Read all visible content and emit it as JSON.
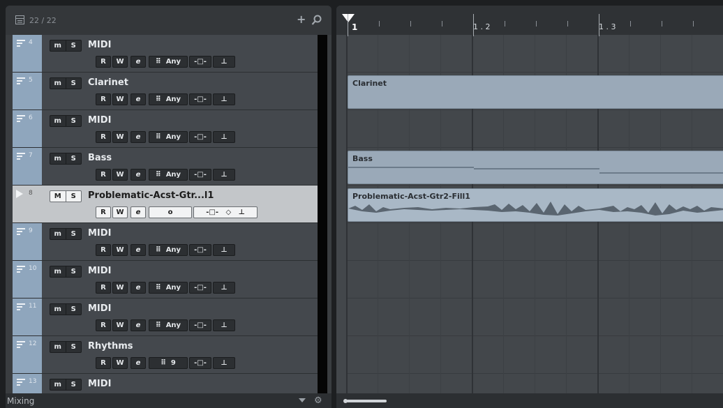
{
  "tracklist": {
    "count": "22 / 22",
    "add_icon": "plus-icon",
    "search_icon": "search-icon",
    "footer_label": "Mixing",
    "tracks": [
      {
        "num": "4",
        "name": "MIDI",
        "mute": "m",
        "solo": "S",
        "r": "R",
        "w": "W",
        "e": "e",
        "kbd": "⠿",
        "mode": "Any",
        "selected": false
      },
      {
        "num": "5",
        "name": "Clarinet",
        "mute": "m",
        "solo": "S",
        "r": "R",
        "w": "W",
        "e": "e",
        "kbd": "⠿",
        "mode": "Any",
        "selected": false
      },
      {
        "num": "6",
        "name": "MIDI",
        "mute": "m",
        "solo": "S",
        "r": "R",
        "w": "W",
        "e": "e",
        "kbd": "⠿",
        "mode": "Any",
        "selected": false
      },
      {
        "num": "7",
        "name": "Bass",
        "mute": "m",
        "solo": "S",
        "r": "R",
        "w": "W",
        "e": "e",
        "kbd": "⠿",
        "mode": "Any",
        "selected": false
      },
      {
        "num": "8",
        "name": "Problematic-Acst-Gtr...l1",
        "mute": "M",
        "solo": "S",
        "r": "R",
        "w": "W",
        "e": "e",
        "kbd": "o",
        "mode": "",
        "selected": true
      },
      {
        "num": "9",
        "name": "MIDI",
        "mute": "m",
        "solo": "S",
        "r": "R",
        "w": "W",
        "e": "e",
        "kbd": "⠿",
        "mode": "Any",
        "selected": false
      },
      {
        "num": "10",
        "name": "MIDI",
        "mute": "m",
        "solo": "S",
        "r": "R",
        "w": "W",
        "e": "e",
        "kbd": "⠿",
        "mode": "Any",
        "selected": false
      },
      {
        "num": "11",
        "name": "MIDI",
        "mute": "m",
        "solo": "S",
        "r": "R",
        "w": "W",
        "e": "e",
        "kbd": "⠿",
        "mode": "Any",
        "selected": false
      },
      {
        "num": "12",
        "name": "Rhythms",
        "mute": "m",
        "solo": "S",
        "r": "R",
        "w": "W",
        "e": "e",
        "kbd": "⠿",
        "mode": "9",
        "selected": false
      },
      {
        "num": "13",
        "name": "MIDI",
        "mute": "m",
        "solo": "S",
        "r": "",
        "w": "",
        "e": "",
        "kbd": "",
        "mode": "",
        "selected": false
      }
    ]
  },
  "ruler": {
    "labels": [
      "1",
      "1 . 2",
      "1 . 3"
    ]
  },
  "events": {
    "clarinet": "Clarinet",
    "bass": "Bass",
    "guitar": "Problematic-Acst-Gtr2-Fill1"
  },
  "colors": {
    "track_strip": "#8fa6bd",
    "event_fill": "#9aa9b8",
    "selected_track": "#c3c6c9"
  }
}
